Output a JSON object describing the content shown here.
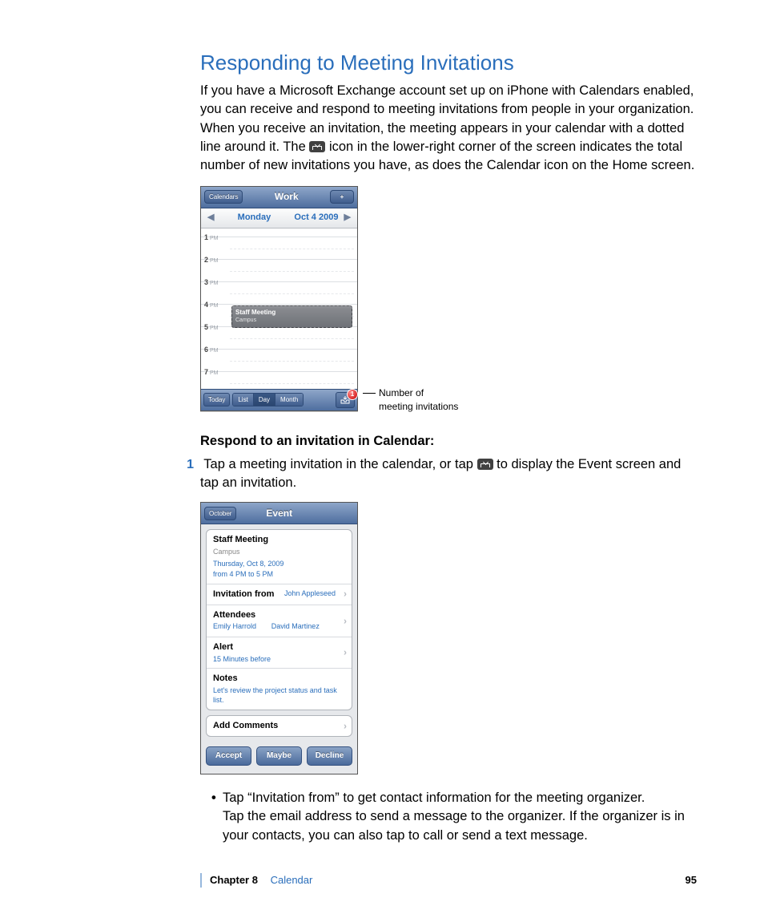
{
  "heading": "Responding to Meeting Invitations",
  "intro_pre": "If you have a Microsoft Exchange account set up on iPhone with Calendars enabled, you can receive and respond to meeting invitations from people in your organization. When you receive an invitation, the meeting appears in your calendar with a dotted line around it. The ",
  "intro_post": " icon in the lower-right corner of the screen indicates the total number of new invitations you have, as does the Calendar icon on the Home screen.",
  "callout_l1": "Number of",
  "callout_l2": "meeting invitations",
  "respond_heading": "Respond to an invitation in Calendar:",
  "step1_num": "1",
  "step1_pre": "Tap a meeting invitation in the calendar, or tap ",
  "step1_post": " to display the Event screen and tap an invitation.",
  "bullet1a": "Tap “Invitation from” to get contact information for the meeting organizer.",
  "bullet1b": "Tap the email address to send a message to the organizer. If the organizer is in your contacts, you can also tap to call or send a text message.",
  "footer_chapter": "Chapter 8",
  "footer_name": "Calendar",
  "page_number": "95",
  "cal": {
    "back": "Calendars",
    "title": "Work",
    "plus": "+",
    "arrow_l": "◀",
    "arrow_r": "▶",
    "day": "Monday",
    "date": "Oct 4 2009",
    "hours": [
      "1",
      "2",
      "3",
      "4",
      "5",
      "6",
      "7"
    ],
    "ampm": "PM",
    "meeting_title": "Staff Meeting",
    "meeting_loc": "Campus",
    "today": "Today",
    "seg_list": "List",
    "seg_day": "Day",
    "seg_month": "Month",
    "badge": "1"
  },
  "event": {
    "back": "October",
    "title": "Event",
    "name": "Staff Meeting",
    "loc": "Campus",
    "date": "Thursday, Oct 8, 2009",
    "time": "from 4 PM to 5 PM",
    "inv_from_label": "Invitation from",
    "inv_from_value": "John Appleseed",
    "attendees_label": "Attendees",
    "attendee1": "Emily Harrold",
    "attendee2": "David Martinez",
    "alert_label": "Alert",
    "alert_value": "15 Minutes before",
    "notes_label": "Notes",
    "notes_value": "Let's review the project status and task list.",
    "add_comments": "Add Comments",
    "accept": "Accept",
    "maybe": "Maybe",
    "decline": "Decline",
    "chev": "›"
  }
}
